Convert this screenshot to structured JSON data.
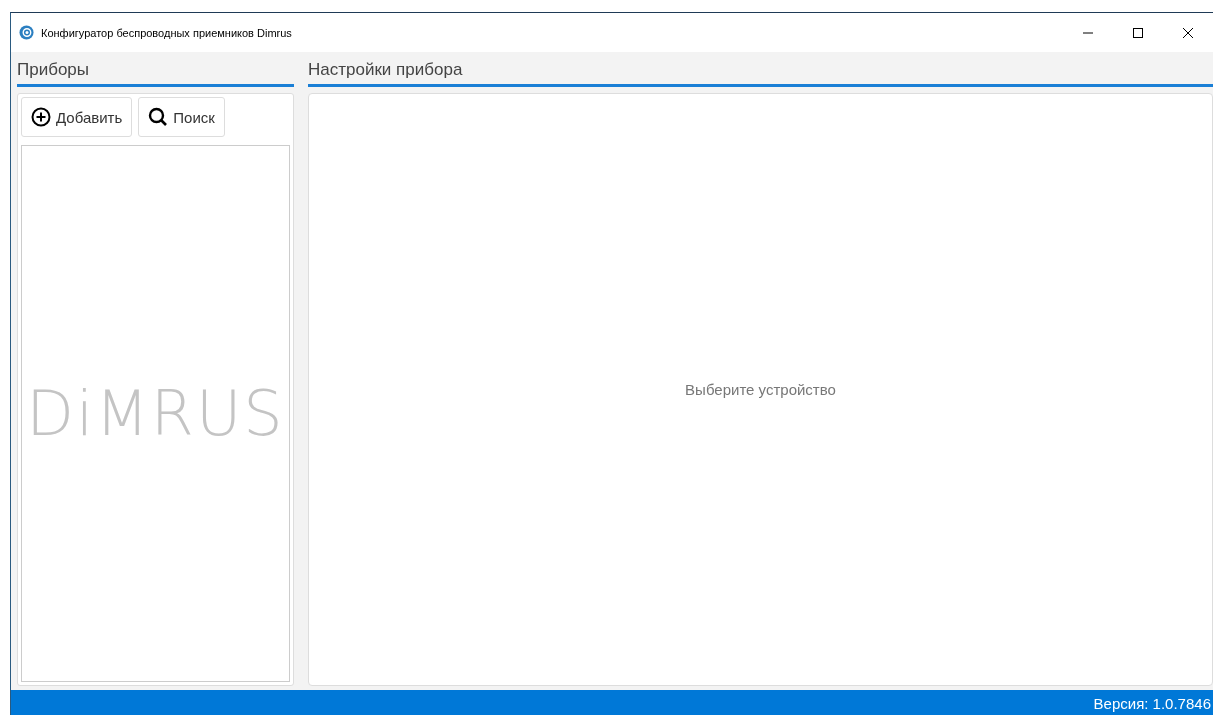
{
  "window": {
    "title": "Конфигуратор беспроводных приемников Dimrus"
  },
  "devices_panel": {
    "title": "Приборы",
    "buttons": [
      {
        "label": "Добавить",
        "kind": "add"
      },
      {
        "label": "Поиск",
        "kind": "search"
      }
    ],
    "watermark": "DiMRUS"
  },
  "settings_panel": {
    "title": "Настройки прибора",
    "placeholder": "Выберите устройство"
  },
  "status_bar": {
    "version": "Версия: 1.0.7846"
  }
}
